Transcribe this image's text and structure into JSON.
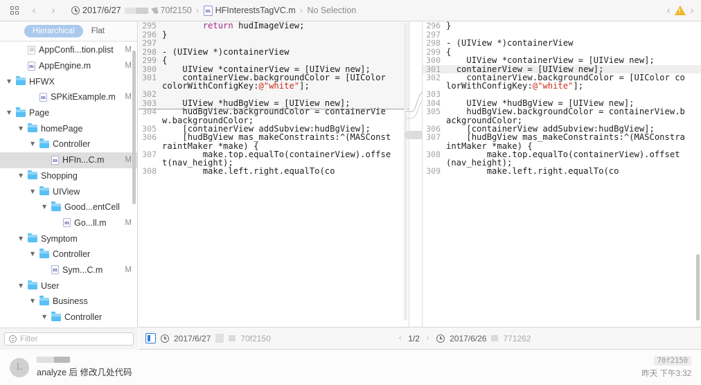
{
  "toolbar": {
    "grid_icon": "grid-icon",
    "back_label": "‹",
    "forward_label": "›",
    "breadcrumb": {
      "date": "2017/6/27",
      "commit_hash": "70f2150",
      "file": "HFInterestsTagVC.m",
      "file_badge": "m",
      "selection": "No Selection",
      "separator": "›"
    },
    "right": {
      "prev_issue": "‹",
      "warning_icon": "warning-triangle-icon",
      "next_issue": "›"
    }
  },
  "sidebar": {
    "segmented": {
      "options": [
        "Hierarchical",
        "Flat"
      ],
      "selected": "Hierarchical"
    },
    "tree": [
      {
        "label": "AppConfi...tion.plist",
        "indent": 1,
        "type": "plist",
        "marker": "M",
        "expanded": null,
        "selected": false
      },
      {
        "label": "AppEngine.m",
        "indent": 1,
        "type": "file",
        "marker": "M",
        "expanded": null,
        "selected": false
      },
      {
        "label": "HFWX",
        "indent": 0,
        "type": "folder",
        "marker": "",
        "expanded": true,
        "selected": false
      },
      {
        "label": "SPKitExample.m",
        "indent": 2,
        "type": "file",
        "marker": "M",
        "expanded": null,
        "selected": false
      },
      {
        "label": "Page",
        "indent": 0,
        "type": "folder",
        "marker": "",
        "expanded": true,
        "selected": false
      },
      {
        "label": "homePage",
        "indent": 1,
        "type": "folder",
        "marker": "",
        "expanded": true,
        "selected": false
      },
      {
        "label": "Controller",
        "indent": 2,
        "type": "folder",
        "marker": "",
        "expanded": true,
        "selected": false
      },
      {
        "label": "HFIn...C.m",
        "indent": 3,
        "type": "file",
        "marker": "M",
        "expanded": null,
        "selected": true
      },
      {
        "label": "Shopping",
        "indent": 1,
        "type": "folder",
        "marker": "",
        "expanded": true,
        "selected": false
      },
      {
        "label": "UIView",
        "indent": 2,
        "type": "folder",
        "marker": "",
        "expanded": true,
        "selected": false
      },
      {
        "label": "Good...entCell",
        "indent": 3,
        "type": "folder",
        "marker": "",
        "expanded": true,
        "selected": false
      },
      {
        "label": "Go...ll.m",
        "indent": 4,
        "type": "file",
        "marker": "M",
        "expanded": null,
        "selected": false
      },
      {
        "label": "Symptom",
        "indent": 1,
        "type": "folder",
        "marker": "",
        "expanded": true,
        "selected": false
      },
      {
        "label": "Controller",
        "indent": 2,
        "type": "folder",
        "marker": "",
        "expanded": true,
        "selected": false
      },
      {
        "label": "Sym...C.m",
        "indent": 3,
        "type": "file",
        "marker": "M",
        "expanded": null,
        "selected": false
      },
      {
        "label": "User",
        "indent": 1,
        "type": "folder",
        "marker": "",
        "expanded": true,
        "selected": false
      },
      {
        "label": "Business",
        "indent": 2,
        "type": "folder",
        "marker": "",
        "expanded": true,
        "selected": false
      },
      {
        "label": "Controller",
        "indent": 3,
        "type": "folder",
        "marker": "",
        "expanded": true,
        "selected": false
      }
    ],
    "filter": {
      "placeholder": "Filter",
      "value": "",
      "icon": "filter-icon"
    }
  },
  "editor": {
    "left": {
      "lines": [
        {
          "no": "295",
          "segments": [
            {
              "t": "        ",
              "c": ""
            },
            {
              "t": "return",
              "c": "kw"
            },
            {
              "t": " hudImageView;",
              "c": ""
            }
          ],
          "highlight": false
        },
        {
          "no": "296",
          "segments": [
            {
              "t": "}",
              "c": ""
            }
          ],
          "highlight": false
        },
        {
          "no": "297",
          "segments": [
            {
              "t": "",
              "c": ""
            }
          ],
          "highlight": false
        },
        {
          "no": "298",
          "segments": [
            {
              "t": "- (UIView *)containerView",
              "c": ""
            }
          ],
          "highlight": false
        },
        {
          "no": "299",
          "segments": [
            {
              "t": "{",
              "c": ""
            }
          ],
          "highlight": false
        },
        {
          "no": "300",
          "segments": [
            {
              "t": "    UIView *containerView = [UIView new];",
              "c": ""
            }
          ],
          "highlight": false
        },
        {
          "no": "301",
          "segments": [
            {
              "t": "    containerView.backgroundColor = [UIColor colorWithConfigKey:",
              "c": ""
            },
            {
              "t": "@\"white\"",
              "c": "str"
            },
            {
              "t": "];",
              "c": ""
            }
          ],
          "highlight": false
        },
        {
          "no": "302",
          "segments": [
            {
              "t": "",
              "c": ""
            }
          ],
          "highlight": false
        },
        {
          "no": "303",
          "segments": [
            {
              "t": "    UIView *hudBgView = [UIView new];",
              "c": ""
            }
          ],
          "highlight": false
        },
        {
          "no": "304",
          "segments": [
            {
              "t": "    hudBgView.backgroundColor = containerView.backgroundColor;",
              "c": ""
            }
          ],
          "highlight": false
        },
        {
          "no": "305",
          "segments": [
            {
              "t": "    [containerView addSubview:hudBgView];",
              "c": ""
            }
          ],
          "highlight": false
        },
        {
          "no": "306",
          "segments": [
            {
              "t": "    [hudBgView mas_makeConstraints:^(MASConstraintMaker *make) {",
              "c": ""
            }
          ],
          "highlight": false
        },
        {
          "no": "307",
          "segments": [
            {
              "t": "        make.top.equalTo(containerView).offset(nav_height);",
              "c": ""
            }
          ],
          "highlight": false
        },
        {
          "no": "308",
          "segments": [
            {
              "t": "        make.left.right.equalTo(co",
              "c": ""
            }
          ],
          "highlight": false
        }
      ]
    },
    "right": {
      "lines": [
        {
          "no": "296",
          "segments": [
            {
              "t": "}",
              "c": ""
            }
          ],
          "highlight": false
        },
        {
          "no": "297",
          "segments": [
            {
              "t": "",
              "c": ""
            }
          ],
          "highlight": false
        },
        {
          "no": "298",
          "segments": [
            {
              "t": "- (UIView *)containerView",
              "c": ""
            }
          ],
          "highlight": false
        },
        {
          "no": "299",
          "segments": [
            {
              "t": "{",
              "c": ""
            }
          ],
          "highlight": false
        },
        {
          "no": "300",
          "segments": [
            {
              "t": "    UIView *containerView = [UIView new];",
              "c": ""
            }
          ],
          "highlight": false
        },
        {
          "no": "301",
          "segments": [
            {
              "t": "  containerView = [UIView new];",
              "c": ""
            }
          ],
          "highlight": true
        },
        {
          "no": "302",
          "segments": [
            {
              "t": "    containerView.backgroundColor = [UIColor colorWithConfigKey:",
              "c": ""
            },
            {
              "t": "@\"white\"",
              "c": "str"
            },
            {
              "t": "];",
              "c": ""
            }
          ],
          "highlight": false
        },
        {
          "no": "303",
          "segments": [
            {
              "t": "",
              "c": ""
            }
          ],
          "highlight": false
        },
        {
          "no": "304",
          "segments": [
            {
              "t": "    UIView *hudBgView = [UIView new];",
              "c": ""
            }
          ],
          "highlight": false
        },
        {
          "no": "305",
          "segments": [
            {
              "t": "    hudBgView.backgroundColor = containerView.backgroundColor;",
              "c": ""
            }
          ],
          "highlight": false
        },
        {
          "no": "306",
          "segments": [
            {
              "t": "    [containerView addSubview:hudBgView];",
              "c": ""
            }
          ],
          "highlight": false
        },
        {
          "no": "307",
          "segments": [
            {
              "t": "    [hudBgView mas_makeConstraints:^(MASConstraintMaker *make) {",
              "c": ""
            }
          ],
          "highlight": false
        },
        {
          "no": "308",
          "segments": [
            {
              "t": "        make.top.equalTo(containerView).offset(nav_height);",
              "c": ""
            }
          ],
          "highlight": false
        },
        {
          "no": "309",
          "segments": [
            {
              "t": "        make.left.right.equalTo(co",
              "c": ""
            }
          ],
          "highlight": false
        }
      ]
    }
  },
  "version_bar": {
    "left": {
      "selector_icon": "editor-selector-icon",
      "clock_icon": "clock-icon",
      "date": "2017/6/27",
      "hash": "70f2150"
    },
    "pager": {
      "prev": "‹",
      "label": "1/2",
      "next": "›"
    },
    "right": {
      "clock_icon": "clock-icon",
      "date": "2017/6/26",
      "hash": "771262"
    }
  },
  "commit": {
    "avatar_letter": "L",
    "message": "analyze 后 修改几处代码",
    "hash": "70f2150",
    "date": "昨天 下午3:32"
  },
  "colors": {
    "accent_blue": "#2f7bdc",
    "segment_blue": "#a9c9ed",
    "folder_blue": "#59c0f5",
    "warning_yellow": "#f0b429",
    "keyword_magenta": "#b3288c",
    "string_red": "#d12f1b"
  }
}
